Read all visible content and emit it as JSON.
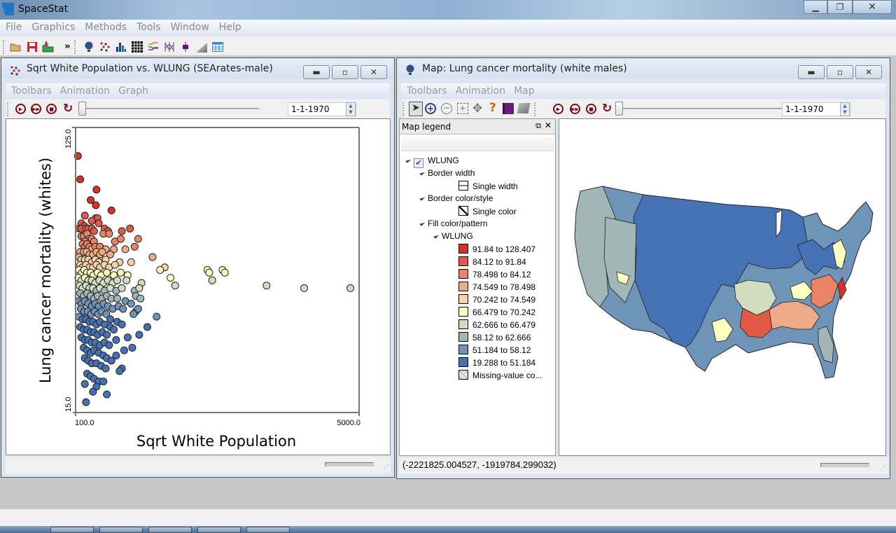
{
  "app": {
    "title": "SpaceStat"
  },
  "menubar": [
    "File",
    "Graphics",
    "Methods",
    "Tools",
    "Window",
    "Help"
  ],
  "toolbar": {
    "file_icons": [
      "open-folder-icon",
      "save-icon",
      "import-icon"
    ],
    "overflow": "»",
    "graphics_icons": [
      "map-globe-icon",
      "scatterplot-icon",
      "histogram-icon",
      "heatmap-grid-icon",
      "time-series-icon",
      "parallel-coords-icon",
      "boxplot-icon",
      "variogram-icon",
      "table-icon"
    ]
  },
  "scatter_window": {
    "title": "Sqrt White Population vs. WLUNG (SEArates-male)",
    "menu": [
      "Toolbars",
      "Animation",
      "Graph"
    ],
    "date": "1-1-1970",
    "playback": [
      "play",
      "fast-forward",
      "stop",
      "refresh"
    ]
  },
  "map_window": {
    "title": "Map: Lung cancer mortality (white males)",
    "menu": [
      "Toolbars",
      "Animation",
      "Map"
    ],
    "date": "1-1-1970",
    "tools": [
      "select-arrow",
      "zoom-in",
      "zoom-out",
      "zoom-extent",
      "pan",
      "help",
      "book",
      "eraser"
    ],
    "legend": {
      "header": "Map legend",
      "layer": "WLUNG",
      "layer_checked": true,
      "border_width_label": "Border width",
      "border_width_value": "Single width",
      "border_color_label": "Border color/style",
      "border_color_value": "Single color",
      "fill_label": "Fill color/pattern",
      "fill_variable": "WLUNG",
      "classes": [
        {
          "label": "91.84 to 128.407",
          "color": "#d73027"
        },
        {
          "label": "84.12 to 91.84",
          "color": "#e05a45"
        },
        {
          "label": "78.498 to 84.12",
          "color": "#ea8465"
        },
        {
          "label": "74.549 to 78.498",
          "color": "#f0ab86"
        },
        {
          "label": "70.242 to 74.549",
          "color": "#f7d3a4"
        },
        {
          "label": "66.479 to 70.242",
          "color": "#ffffc0"
        },
        {
          "label": "62.666 to 66.479",
          "color": "#d2dcbe"
        },
        {
          "label": "58.12 to 62.666",
          "color": "#a2b6b8"
        },
        {
          "label": "51.184 to 58.12",
          "color": "#6e95b8"
        },
        {
          "label": "19.288 to 51.184",
          "color": "#4472b4"
        }
      ],
      "missing_label": "Missing-value co..."
    },
    "status_coords": "(-2221825.004527, -1919784.299032)"
  },
  "chart_data": {
    "type": "scatter",
    "title": "Sqrt White Population vs. WLUNG (SEArates-male)",
    "xlabel": "Sqrt White Population",
    "ylabel": "Lung cancer mortality (whites)",
    "xlim": [
      100.0,
      5000.0
    ],
    "ylim": [
      15.0,
      125.0
    ],
    "x_tick_labels": [
      "100.0",
      "5000.0"
    ],
    "y_tick_labels": [
      "15.0",
      "125.0"
    ],
    "grid": false,
    "points": [
      [
        140,
        114
      ],
      [
        180,
        105
      ],
      [
        460,
        101
      ],
      [
        360,
        97
      ],
      [
        450,
        95
      ],
      [
        720,
        93
      ],
      [
        260,
        91
      ],
      [
        200,
        88
      ],
      [
        250,
        87
      ],
      [
        450,
        90
      ],
      [
        480,
        90
      ],
      [
        380,
        89
      ],
      [
        500,
        88
      ],
      [
        160,
        86
      ],
      [
        200,
        86
      ],
      [
        280,
        86
      ],
      [
        320,
        86
      ],
      [
        380,
        86
      ],
      [
        420,
        85
      ],
      [
        600,
        86
      ],
      [
        660,
        85
      ],
      [
        900,
        85
      ],
      [
        1040,
        86
      ],
      [
        580,
        84
      ],
      [
        680,
        84
      ],
      [
        200,
        83
      ],
      [
        240,
        83
      ],
      [
        300,
        84
      ],
      [
        340,
        82
      ],
      [
        260,
        81
      ],
      [
        380,
        82
      ],
      [
        420,
        81
      ],
      [
        780,
        81
      ],
      [
        880,
        82
      ],
      [
        1180,
        82
      ],
      [
        220,
        80
      ],
      [
        260,
        79
      ],
      [
        300,
        80
      ],
      [
        340,
        79
      ],
      [
        380,
        78
      ],
      [
        440,
        79
      ],
      [
        520,
        79
      ],
      [
        620,
        78
      ],
      [
        760,
        78
      ],
      [
        960,
        78
      ],
      [
        1120,
        79
      ],
      [
        180,
        77
      ],
      [
        240,
        77
      ],
      [
        290,
        77
      ],
      [
        340,
        76
      ],
      [
        400,
        76
      ],
      [
        460,
        77
      ],
      [
        520,
        76
      ],
      [
        560,
        77
      ],
      [
        700,
        76
      ],
      [
        1430,
        75
      ],
      [
        160,
        75
      ],
      [
        200,
        74
      ],
      [
        260,
        74
      ],
      [
        320,
        74
      ],
      [
        380,
        73
      ],
      [
        440,
        74
      ],
      [
        500,
        73
      ],
      [
        620,
        74
      ],
      [
        860,
        73
      ],
      [
        1060,
        73
      ],
      [
        180,
        72
      ],
      [
        220,
        71
      ],
      [
        280,
        72
      ],
      [
        340,
        71
      ],
      [
        400,
        71
      ],
      [
        460,
        72
      ],
      [
        520,
        71
      ],
      [
        600,
        72
      ],
      [
        680,
        71
      ],
      [
        780,
        72
      ],
      [
        1640,
        71
      ],
      [
        1560,
        70
      ],
      [
        2380,
        70
      ],
      [
        2410,
        69
      ],
      [
        2640,
        70
      ],
      [
        2680,
        69
      ],
      [
        160,
        70
      ],
      [
        210,
        69
      ],
      [
        250,
        70
      ],
      [
        300,
        69
      ],
      [
        360,
        69
      ],
      [
        410,
        68
      ],
      [
        480,
        69
      ],
      [
        540,
        68
      ],
      [
        640,
        69
      ],
      [
        760,
        68
      ],
      [
        880,
        69
      ],
      [
        1000,
        68
      ],
      [
        1740,
        67
      ],
      [
        2460,
        66
      ],
      [
        150,
        67
      ],
      [
        200,
        66
      ],
      [
        260,
        67
      ],
      [
        320,
        66
      ],
      [
        380,
        66
      ],
      [
        440,
        65
      ],
      [
        510,
        66
      ],
      [
        580,
        65
      ],
      [
        660,
        66
      ],
      [
        740,
        65
      ],
      [
        820,
        66
      ],
      [
        980,
        66
      ],
      [
        1240,
        65
      ],
      [
        3400,
        64
      ],
      [
        4050,
        63
      ],
      [
        4850,
        63
      ],
      [
        170,
        64
      ],
      [
        220,
        63
      ],
      [
        280,
        64
      ],
      [
        340,
        63
      ],
      [
        400,
        63
      ],
      [
        460,
        62
      ],
      [
        520,
        63
      ],
      [
        600,
        62
      ],
      [
        700,
        63
      ],
      [
        800,
        62
      ],
      [
        900,
        63
      ],
      [
        1120,
        62
      ],
      [
        1200,
        63
      ],
      [
        1820,
        64
      ],
      [
        180,
        61
      ],
      [
        240,
        60
      ],
      [
        300,
        61
      ],
      [
        360,
        60
      ],
      [
        420,
        59
      ],
      [
        480,
        60
      ],
      [
        560,
        59
      ],
      [
        640,
        60
      ],
      [
        720,
        59
      ],
      [
        820,
        59
      ],
      [
        960,
        58
      ],
      [
        1140,
        60
      ],
      [
        1220,
        59
      ],
      [
        160,
        58
      ],
      [
        200,
        57
      ],
      [
        260,
        58
      ],
      [
        320,
        57
      ],
      [
        380,
        56
      ],
      [
        440,
        57
      ],
      [
        500,
        56
      ],
      [
        580,
        57
      ],
      [
        660,
        56
      ],
      [
        740,
        55
      ],
      [
        840,
        56
      ],
      [
        920,
        55
      ],
      [
        1060,
        57
      ],
      [
        1140,
        54
      ],
      [
        1180,
        55
      ],
      [
        190,
        55
      ],
      [
        250,
        54
      ],
      [
        310,
        54
      ],
      [
        370,
        53
      ],
      [
        430,
        54
      ],
      [
        490,
        53
      ],
      [
        550,
        54
      ],
      [
        630,
        53
      ],
      [
        1500,
        52
      ],
      [
        1100,
        53
      ],
      [
        700,
        51
      ],
      [
        160,
        52
      ],
      [
        220,
        51
      ],
      [
        280,
        51
      ],
      [
        340,
        50
      ],
      [
        400,
        50
      ],
      [
        460,
        49
      ],
      [
        520,
        50
      ],
      [
        600,
        49
      ],
      [
        700,
        48
      ],
      [
        820,
        50
      ],
      [
        900,
        49
      ],
      [
        1340,
        48
      ],
      [
        180,
        48
      ],
      [
        240,
        47
      ],
      [
        300,
        47
      ],
      [
        360,
        46
      ],
      [
        420,
        46
      ],
      [
        480,
        45
      ],
      [
        560,
        46
      ],
      [
        640,
        45
      ],
      [
        760,
        47
      ],
      [
        1000,
        44
      ],
      [
        1200,
        45
      ],
      [
        200,
        44
      ],
      [
        260,
        43
      ],
      [
        320,
        43
      ],
      [
        380,
        42
      ],
      [
        440,
        42
      ],
      [
        520,
        41
      ],
      [
        600,
        42
      ],
      [
        680,
        41
      ],
      [
        800,
        43
      ],
      [
        1080,
        40
      ],
      [
        240,
        40
      ],
      [
        300,
        39
      ],
      [
        360,
        38
      ],
      [
        420,
        39
      ],
      [
        500,
        38
      ],
      [
        580,
        37
      ],
      [
        640,
        36
      ],
      [
        800,
        37
      ],
      [
        940,
        39
      ],
      [
        260,
        36
      ],
      [
        320,
        35
      ],
      [
        380,
        34
      ],
      [
        460,
        34
      ],
      [
        540,
        33
      ],
      [
        620,
        32
      ],
      [
        720,
        35
      ],
      [
        900,
        32
      ],
      [
        300,
        30
      ],
      [
        360,
        29
      ],
      [
        420,
        28
      ],
      [
        500,
        27
      ],
      [
        580,
        27
      ],
      [
        460,
        25
      ],
      [
        260,
        26
      ],
      [
        400,
        23
      ],
      [
        640,
        22
      ],
      [
        860,
        31
      ],
      [
        280,
        19
      ]
    ]
  }
}
